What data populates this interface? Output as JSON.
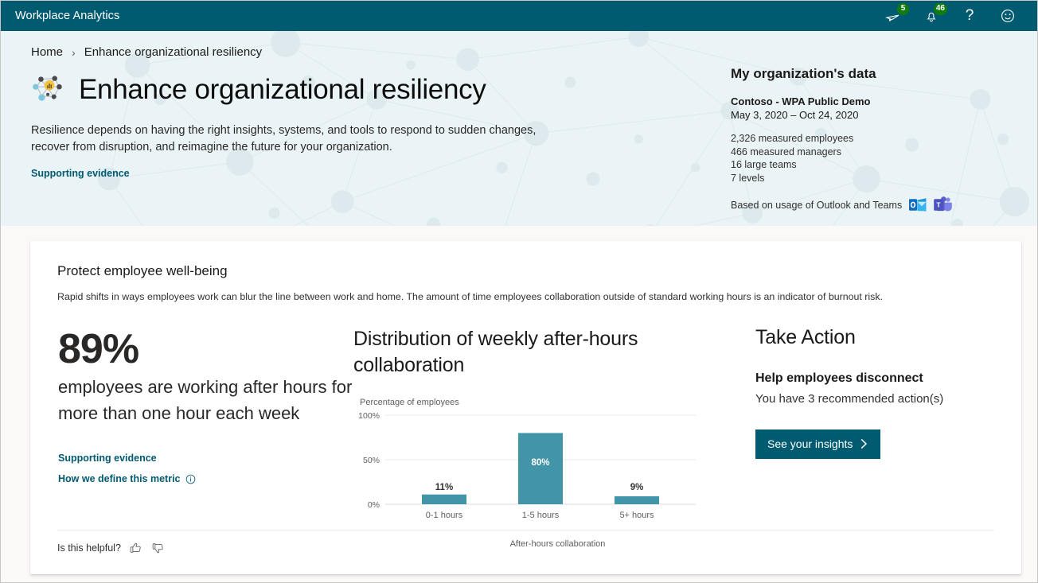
{
  "topbar": {
    "app_title": "Workplace Analytics",
    "brand_color": "#005a70",
    "badge_color": "#107c10",
    "icons": [
      {
        "name": "send-icon",
        "badge": "5"
      },
      {
        "name": "bell-icon",
        "badge": "46"
      },
      {
        "name": "help-icon",
        "label": "?"
      },
      {
        "name": "feedback-smiley-icon",
        "label": ""
      }
    ]
  },
  "hero": {
    "breadcrumb": {
      "home": "Home",
      "separator": "›",
      "current": "Enhance organizational resiliency"
    },
    "title": "Enhance organizational resiliency",
    "description": "Resilience depends on having the right insights, systems, and tools to respond to sudden changes, recover from disruption, and reimagine the future for your organization.",
    "supporting_evidence": "Supporting evidence",
    "background_color": "#eaf3f5"
  },
  "org_panel": {
    "heading": "My organization's data",
    "org_name": "Contoso - WPA Public Demo",
    "date_range": "May 3, 2020 – Oct 24, 2020",
    "stats": [
      "2,326 measured employees",
      "466 measured managers",
      "16 large teams",
      "7 levels"
    ],
    "based_on": "Based on usage of Outlook and Teams",
    "source_icons": [
      "outlook-icon",
      "teams-icon"
    ]
  },
  "card": {
    "heading": "Protect employee well-being",
    "subheading": "Rapid shifts in ways employees work can blur the line between work and home. The amount of time employees collaboration outside of standard working hours is an indicator of burnout risk.",
    "stat": {
      "value": "89%",
      "text": "employees are working after hours for more than one hour each week",
      "supporting_evidence": "Supporting evidence",
      "define_metric": "How we define this metric",
      "info_icon": "info-icon"
    },
    "take_action": {
      "heading": "Take Action",
      "subheading": "Help employees disconnect",
      "description": "You have 3 recommended action(s)",
      "button_label": "See your insights",
      "button_chevron": "›",
      "button_color": "#005a70"
    },
    "footer": {
      "helpful_label": "Is this helpful?",
      "thumbs_up_icon": "thumbs-up-icon",
      "thumbs_down_icon": "thumbs-down-icon"
    }
  },
  "chart_data": {
    "type": "bar",
    "title": "Distribution of weekly after-hours collaboration",
    "ylabel": "Percentage of employees",
    "xlabel": "After-hours collaboration",
    "categories": [
      "0-1 hours",
      "1-5 hours",
      "5+ hours"
    ],
    "values": [
      11,
      80,
      9
    ],
    "value_labels": [
      "11%",
      "80%",
      "9%"
    ],
    "ytick_labels": [
      "100%",
      "50%",
      "0%"
    ],
    "yticks": [
      100,
      50,
      0
    ],
    "ylim": [
      0,
      100
    ],
    "bar_color": "#4295a8",
    "grid": true,
    "legend": false
  }
}
